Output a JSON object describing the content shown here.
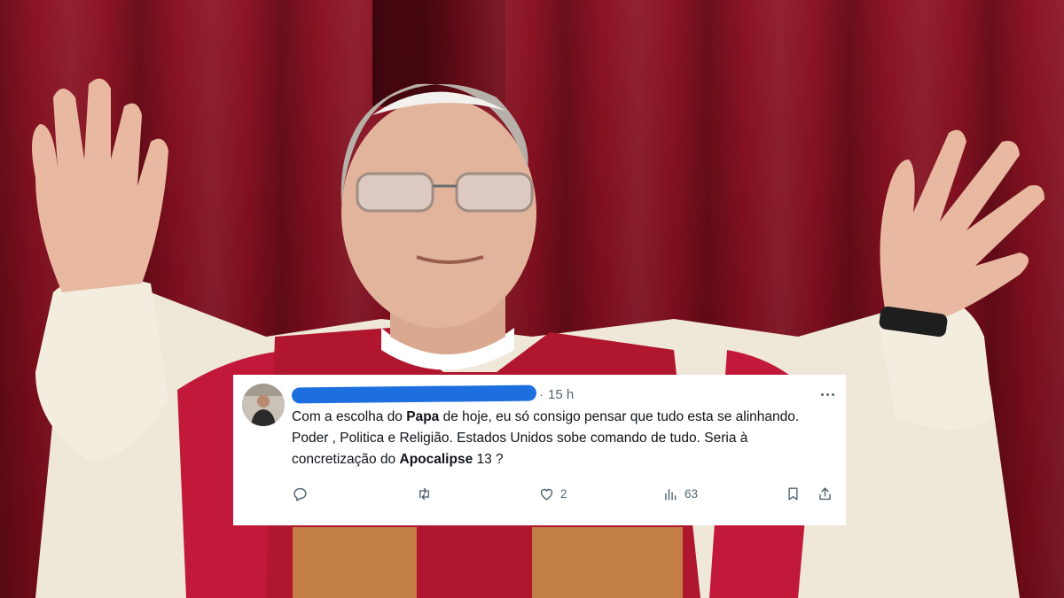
{
  "tweet": {
    "separator": "·",
    "time": "15 h",
    "text": {
      "p1": "Com a escolha do ",
      "b1": "Papa",
      "p2": " de hoje, eu só consigo pensar que tudo esta se alinhando. Poder , Politica e Religião. Estados Unidos sobe comando de tudo. Seria à concretização do ",
      "b2": "Apocalipse",
      "p3": " 13 ?"
    },
    "actions": {
      "reply_count": "",
      "retweet_count": "",
      "like_count": "2",
      "views_count": "63"
    },
    "icons": [
      "more-icon",
      "reply-icon",
      "retweet-icon",
      "like-icon",
      "views-icon",
      "bookmark-icon",
      "share-icon"
    ]
  },
  "colors": {
    "background_curtain": "#7e0f1c",
    "card_background": "#ffffff",
    "redaction": "#1d6fe0",
    "muted_text": "#536471",
    "body_text": "#0f1419"
  }
}
